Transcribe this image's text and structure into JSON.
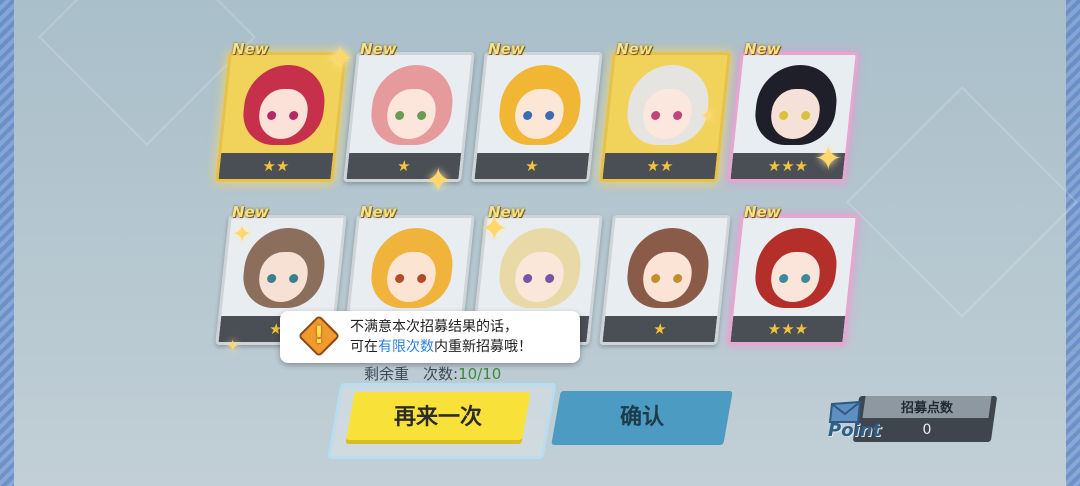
{
  "cards": [
    {
      "new_label": "New",
      "stars": "★★",
      "rarity": 2,
      "hair": "#c7304a",
      "skin": "#fbe1d8",
      "eye": "#b52a66",
      "frame_bg": "gold"
    },
    {
      "new_label": "New",
      "stars": "★",
      "rarity": 1,
      "hair": "#e79a9c",
      "skin": "#fce6dc",
      "eye": "#6a9d54",
      "frame_bg": "light"
    },
    {
      "new_label": "New",
      "stars": "★",
      "rarity": 1,
      "hair": "#f1b634",
      "skin": "#fce6d6",
      "eye": "#3a6cb3",
      "frame_bg": "light"
    },
    {
      "new_label": "New",
      "stars": "★★",
      "rarity": 2,
      "hair": "#e6e4e0",
      "skin": "#fbe7de",
      "eye": "#c2457a",
      "frame_bg": "gold"
    },
    {
      "new_label": "New",
      "stars": "★★★",
      "rarity": 3,
      "hair": "#1f1f2a",
      "skin": "#f6e1d8",
      "eye": "#d8c23a",
      "frame_bg": "light"
    },
    {
      "new_label": "New",
      "stars": "★",
      "rarity": 1,
      "hair": "#8b6e5c",
      "skin": "#f7e0d4",
      "eye": "#3a7f8c",
      "frame_bg": "light"
    },
    {
      "new_label": "New",
      "stars": "★",
      "rarity": 1,
      "hair": "#f0b43c",
      "skin": "#fce4d2",
      "eye": "#b24a2c",
      "frame_bg": "light"
    },
    {
      "new_label": "New",
      "stars": "★",
      "rarity": 1,
      "hair": "#e9d9a6",
      "skin": "#fbe6da",
      "eye": "#7a52a8",
      "frame_bg": "light"
    },
    {
      "new_label": "",
      "stars": "★",
      "rarity": 1,
      "hair": "#8a5b49",
      "skin": "#fbe3d6",
      "eye": "#c2902a",
      "frame_bg": "light"
    },
    {
      "new_label": "New",
      "stars": "★★★",
      "rarity": 3,
      "hair": "#b52f2a",
      "skin": "#fbe4da",
      "eye": "#3a8a9a",
      "frame_bg": "light"
    }
  ],
  "tooltip": {
    "line1": "不满意本次招募结果的话，",
    "line2_pre": "可在",
    "line2_highlight": "有限次数",
    "line2_post": "内重新招募哦！",
    "warn_mark": "!"
  },
  "remain": {
    "label_visible": "剩余重",
    "label_tail": "次数:",
    "count": "10/10"
  },
  "buttons": {
    "again": "再来一次",
    "confirm": "确认"
  },
  "points": {
    "title": "招募点数",
    "value": "0",
    "word": "Point"
  },
  "colors": {
    "gold": "#f1d35c",
    "star": "#f2c23a",
    "accent_yellow": "#f8e23a",
    "accent_blue": "#4b9bc3"
  }
}
